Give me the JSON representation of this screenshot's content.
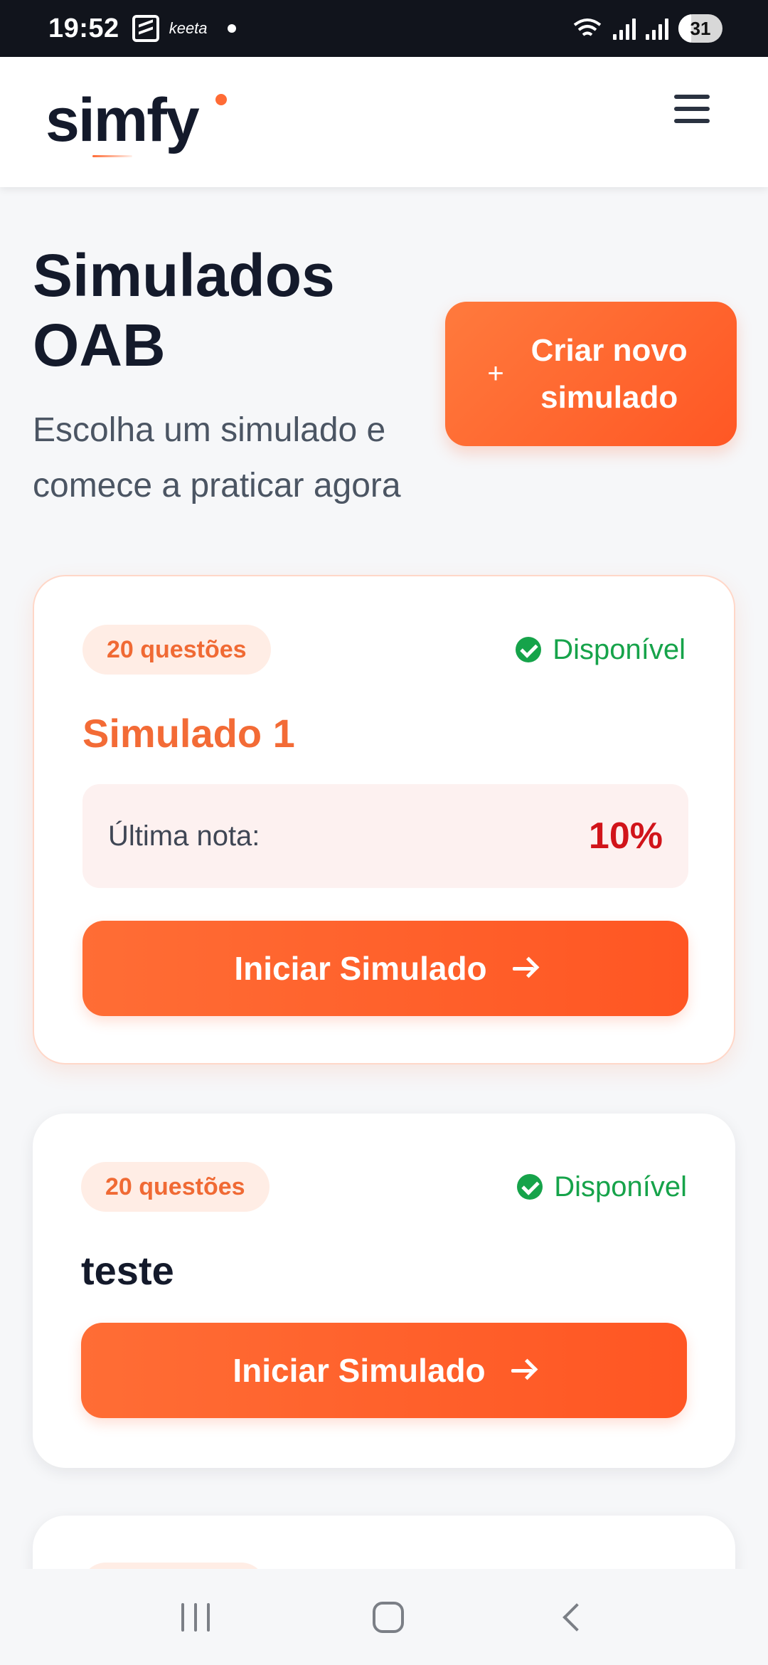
{
  "status_bar": {
    "time": "19:52",
    "app_hint": "keeta",
    "battery": "31"
  },
  "header": {
    "logo": "simfy",
    "accent_color": "#ff6b35"
  },
  "hero": {
    "title": "Simulados OAB",
    "subtitle": "Escolha um simulado e comece a praticar agora",
    "create_button": "Criar novo simulado",
    "create_icon": "+"
  },
  "cards": [
    {
      "badge": "20 questões",
      "status": "Disponível",
      "title": "Simulado 1",
      "last_grade_label": "Última nota:",
      "last_grade_value": "10%",
      "button": "Iniciar Simulado"
    },
    {
      "badge": "20 questões",
      "status": "Disponível",
      "title": "teste",
      "button": "Iniciar Simulado"
    }
  ],
  "colors": {
    "primary": "#ff5f2e",
    "available": "#16a34a",
    "grade": "#d1141a"
  }
}
